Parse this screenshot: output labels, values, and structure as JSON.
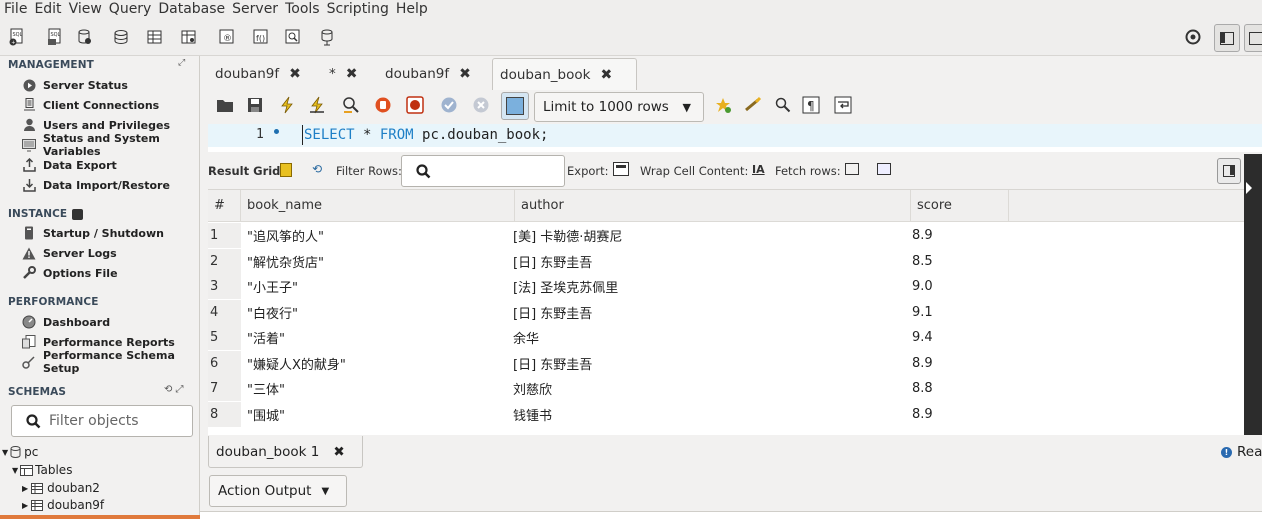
{
  "menu": [
    "File",
    "Edit",
    "View",
    "Query",
    "Database",
    "Server",
    "Tools",
    "Scripting",
    "Help"
  ],
  "sidebar": {
    "management_title": "MANAGEMENT",
    "management_items": [
      "Server Status",
      "Client Connections",
      "Users and Privileges",
      "Status and System Variables",
      "Data Export",
      "Data Import/Restore"
    ],
    "instance_title": "INSTANCE",
    "instance_items": [
      "Startup / Shutdown",
      "Server Logs",
      "Options File"
    ],
    "performance_title": "PERFORMANCE",
    "performance_items": [
      "Dashboard",
      "Performance Reports",
      "Performance Schema Setup"
    ],
    "schemas_title": "SCHEMAS",
    "filter_placeholder": "Filter objects",
    "tree": {
      "schema": "pc",
      "tables_label": "Tables",
      "tables": [
        "douban2",
        "douban9f"
      ]
    }
  },
  "tabs": [
    {
      "label": "douban9f",
      "active": false
    },
    {
      "label": "*",
      "active": false
    },
    {
      "label": "douban9f",
      "active": false
    },
    {
      "label": "douban_book",
      "active": true
    }
  ],
  "query_toolbar": {
    "limit_label": "Limit to 1000 rows"
  },
  "editor": {
    "line_number": "1",
    "kw1": "SELECT",
    "star": " * ",
    "kw2": "FROM",
    "rest": " pc.douban_book;"
  },
  "result_bar": {
    "result_grid": "Result Grid",
    "filter_rows": "Filter Rows:",
    "export": "Export:",
    "wrap": "Wrap Cell Content:",
    "fetch": "Fetch rows:"
  },
  "grid": {
    "columns": [
      "#",
      "book_name",
      "author",
      "score"
    ],
    "rows": [
      [
        "1",
        "\"追风筝的人\"",
        "[美] 卡勒德·胡赛尼",
        "8.9"
      ],
      [
        "2",
        "\"解忧杂货店\"",
        "[日] 东野圭吾",
        "8.5"
      ],
      [
        "3",
        "\"小王子\"",
        "[法] 圣埃克苏佩里",
        "9.0"
      ],
      [
        "4",
        "\"白夜行\"",
        "[日] 东野圭吾",
        "9.1"
      ],
      [
        "5",
        "\"活着\"",
        "余华",
        "9.4"
      ],
      [
        "6",
        "\"嫌疑人X的献身\"",
        "[日] 东野圭吾",
        "8.9"
      ],
      [
        "7",
        "\"三体\"",
        "刘慈欣",
        "8.8"
      ],
      [
        "8",
        "\"围城\"",
        "钱锺书",
        "8.9"
      ]
    ]
  },
  "bottom": {
    "result_tab": "douban_book 1",
    "read_status": "Rea",
    "action_output": "Action Output"
  },
  "colors": {
    "keyword": "#1e7fc6",
    "sidebar_bg": "#f2f1f0",
    "scrollbar": "#2c2c2c"
  }
}
